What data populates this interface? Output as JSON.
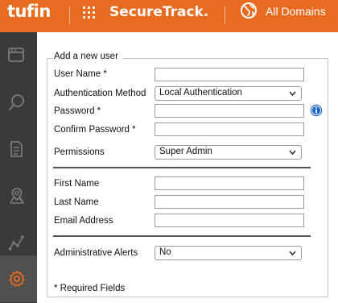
{
  "header": {
    "logo": "tufin",
    "product": "SecureTrack.",
    "domain_selector": "All Domains"
  },
  "sidebar": {
    "items": [
      {
        "icon": "browser-window-icon"
      },
      {
        "icon": "search-icon"
      },
      {
        "icon": "document-icon"
      },
      {
        "icon": "map-pin-icon"
      },
      {
        "icon": "path-route-icon"
      },
      {
        "icon": "gear-icon",
        "active": true
      }
    ]
  },
  "form": {
    "legend": "Add a new user",
    "fields": {
      "username": {
        "label": "User Name *",
        "value": ""
      },
      "auth_method": {
        "label": "Authentication Method",
        "value": "Local Authentication"
      },
      "password": {
        "label": "Password *",
        "value": ""
      },
      "confirm_password": {
        "label": "Confirm Password *",
        "value": ""
      },
      "permissions": {
        "label": "Permissions",
        "value": "Super Admin"
      },
      "first_name": {
        "label": "First Name",
        "value": ""
      },
      "last_name": {
        "label": "Last Name",
        "value": ""
      },
      "email": {
        "label": "Email Address",
        "value": ""
      },
      "admin_alerts": {
        "label": "Administrative Alerts",
        "value": "No"
      }
    },
    "footnote": "* Required Fields"
  },
  "colors": {
    "brand_orange": "#e86b1f",
    "sidebar_bg": "#3a3a3a",
    "sidebar_icon": "#7a7a7a",
    "active_icon": "#e86b1f",
    "info_blue": "#1a66c9"
  }
}
